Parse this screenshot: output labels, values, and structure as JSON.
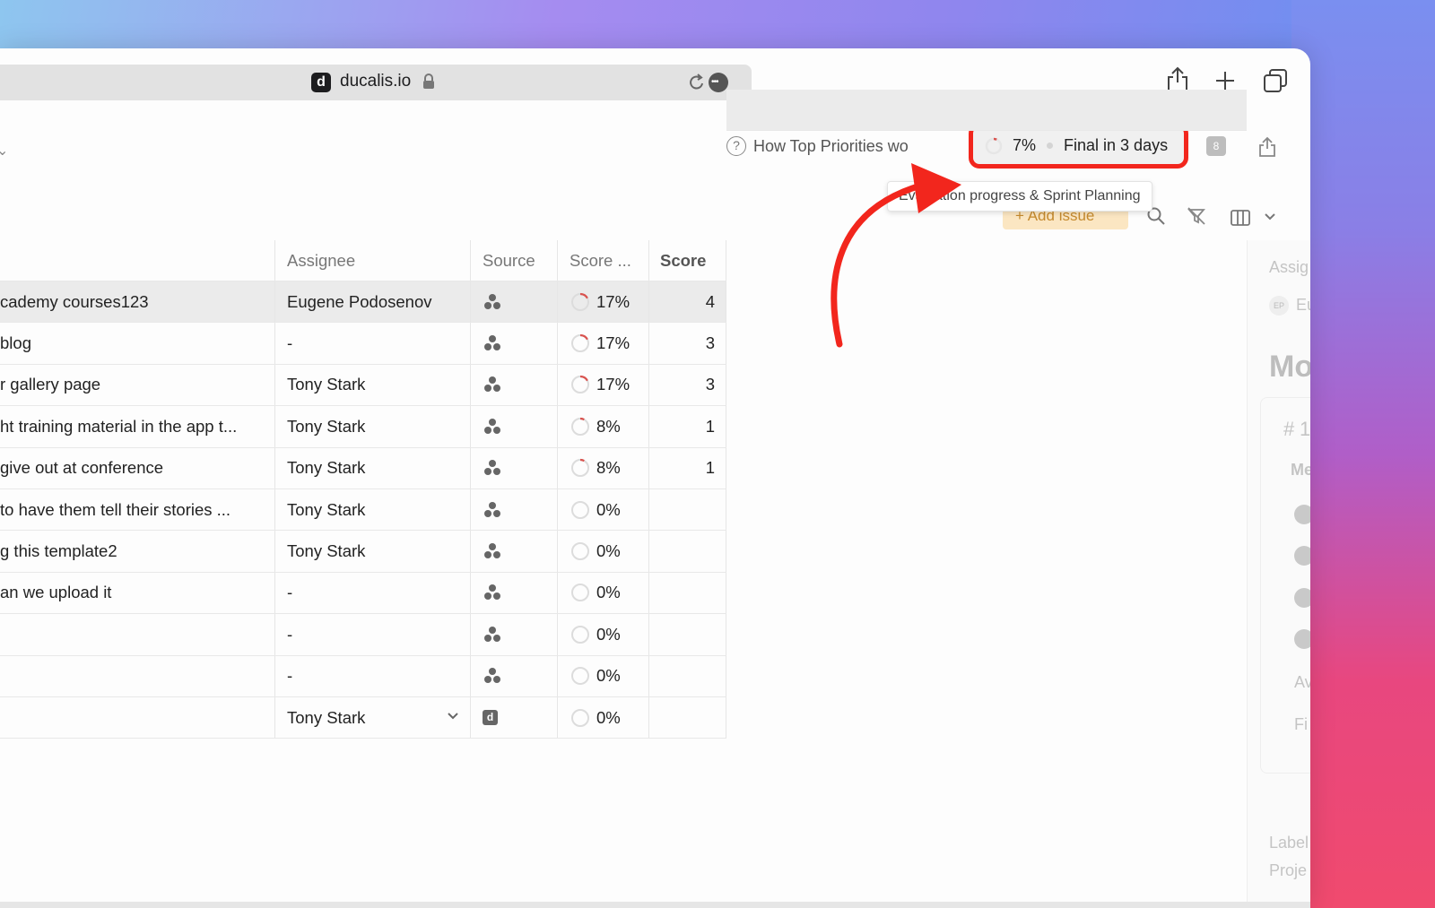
{
  "browser": {
    "url": "ducalis.io",
    "favicon_letter": "d"
  },
  "header": {
    "help_link": "How Top Priorities wo",
    "progress_percent": "7%",
    "progress_value": 0.07,
    "final_text": "Final in 3 days",
    "tooltip": "Evaluation progress & Sprint Planning",
    "add_issue_label": "Add issue",
    "badge_count": "8",
    "highlight_color": "#f2261d"
  },
  "table": {
    "columns": [
      "Assignee",
      "Source",
      "Score ...",
      "Score"
    ],
    "rows": [
      {
        "title": "cademy courses123",
        "assignee": "Eugene Podosenov",
        "source": "cluster",
        "score_pct": "17%",
        "score": "4",
        "selected": true
      },
      {
        "title": "blog",
        "assignee": "-",
        "source": "cluster",
        "score_pct": "17%",
        "score": "3"
      },
      {
        "title": "r gallery page",
        "assignee": "Tony Stark",
        "source": "cluster",
        "score_pct": "17%",
        "score": "3"
      },
      {
        "title": "ht training material in the app t...",
        "assignee": "Tony Stark",
        "source": "cluster",
        "score_pct": "8%",
        "score": "1"
      },
      {
        "title": "give out at conference",
        "assignee": "Tony Stark",
        "source": "cluster",
        "score_pct": "8%",
        "score": "1"
      },
      {
        "title": " to have them tell their stories ...",
        "assignee": "Tony Stark",
        "source": "cluster",
        "score_pct": "0%",
        "score": ""
      },
      {
        "title": "g this template2",
        "assignee": "Tony Stark",
        "source": "cluster",
        "score_pct": "0%",
        "score": ""
      },
      {
        "title": "an we upload it",
        "assignee": "-",
        "source": "cluster",
        "score_pct": "0%",
        "score": ""
      },
      {
        "title": "",
        "assignee": "-",
        "source": "cluster",
        "score_pct": "0%",
        "score": ""
      },
      {
        "title": "",
        "assignee": "-",
        "source": "cluster",
        "score_pct": "0%",
        "score": ""
      },
      {
        "title": "",
        "assignee": "Tony Stark",
        "source": "d",
        "score_pct": "0%",
        "score": ""
      }
    ]
  },
  "side_panel": {
    "assignee_label": "Assig",
    "assignee_initials": "EP",
    "assignee_name": "Eu",
    "heading": "Mo",
    "hash": "#",
    "hash_num": "1",
    "tab": "Me",
    "item_av": "Av",
    "item_fi": "Fi",
    "labels": "Label",
    "project": "Proje"
  }
}
